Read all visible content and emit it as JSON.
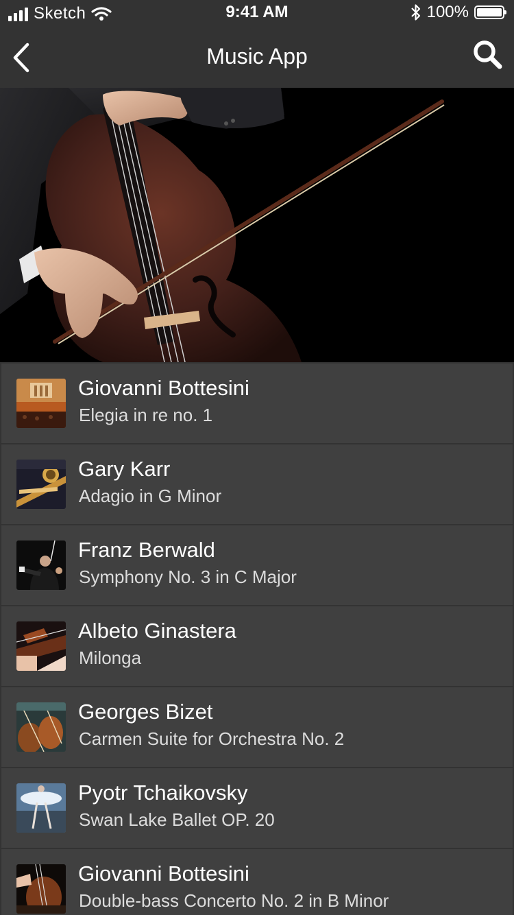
{
  "status_bar": {
    "carrier": "Sketch",
    "time": "9:41 AM",
    "battery": "100%",
    "battery_level": 1.0,
    "icons": [
      "signal-icon",
      "wifi-icon",
      "bluetooth-icon",
      "battery-icon"
    ]
  },
  "nav": {
    "title": "Music App",
    "back_icon": "chevron-left-icon",
    "search_icon": "search-icon"
  },
  "hero": {
    "image": "cello-player-photo"
  },
  "tracks": [
    {
      "artist": "Giovanni Bottesini",
      "title": "Elegia in re no. 1",
      "thumb": "concert-hall-thumbnail"
    },
    {
      "artist": "Gary Karr",
      "title": "Adagio in G Minor",
      "thumb": "brass-instruments-thumbnail"
    },
    {
      "artist": "Franz Berwald",
      "title": "Symphony No. 3 in C Major",
      "thumb": "conductor-thumbnail"
    },
    {
      "artist": "Albeto Ginastera",
      "title": "Milonga",
      "thumb": "violinists-thumbnail"
    },
    {
      "artist": "Georges Bizet",
      "title": "Carmen Suite for Orchestra No. 2",
      "thumb": "cellos-thumbnail"
    },
    {
      "artist": "Pyotr Tchaikovsky",
      "title": "Swan Lake Ballet OP. 20",
      "thumb": "ballet-thumbnail"
    },
    {
      "artist": "Giovanni Bottesini",
      "title": "Double-bass Concerto No. 2 in B Minor",
      "thumb": "double-bass-thumbnail"
    }
  ],
  "colors": {
    "background": "#3b3b3b",
    "bar": "#333333",
    "row": "#404040",
    "text": "#ffffff",
    "subtext": "#dcdcdc"
  }
}
